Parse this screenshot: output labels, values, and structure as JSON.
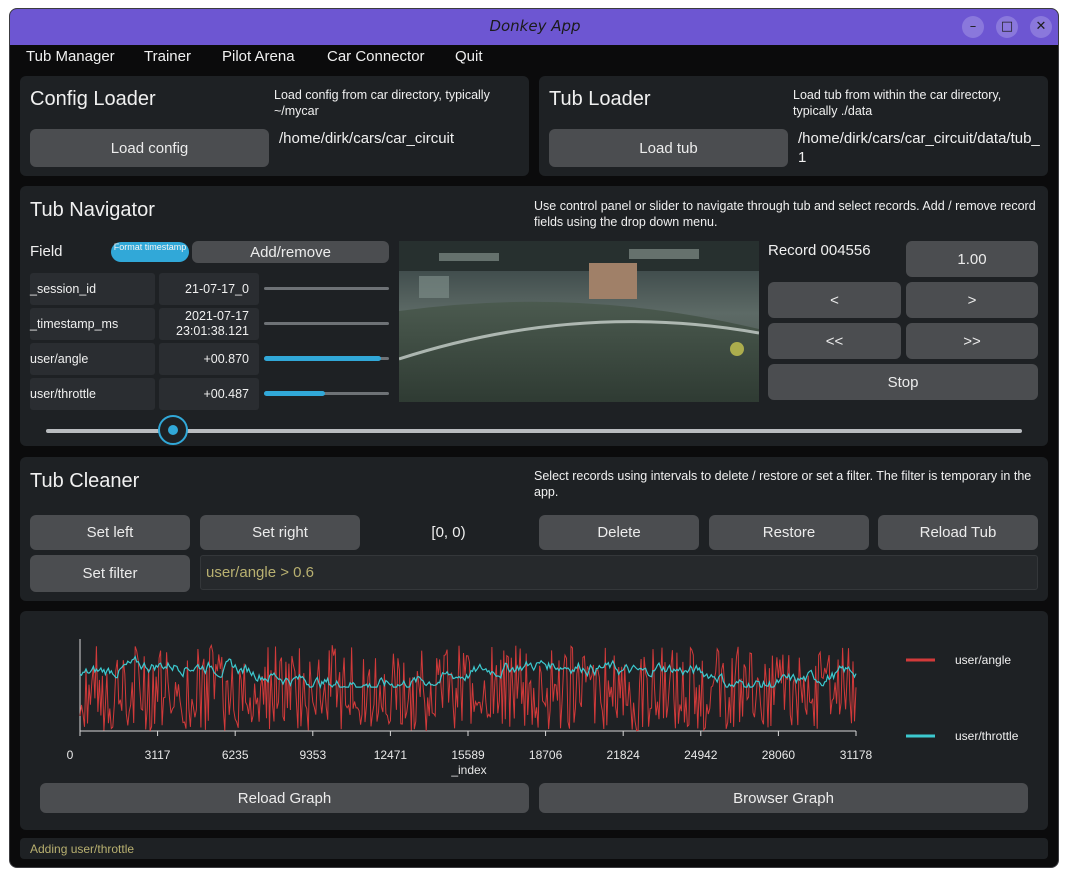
{
  "window": {
    "title": "Donkey App"
  },
  "menu": [
    "Tub Manager",
    "Trainer",
    "Pilot Arena",
    "Car Connector",
    "Quit"
  ],
  "config_loader": {
    "title": "Config Loader",
    "hint": "Load config from car directory, typically ~/mycar",
    "button": "Load config",
    "path": "/home/dirk/cars/car_circuit"
  },
  "tub_loader": {
    "title": "Tub Loader",
    "hint": "Load tub from within the car directory, typically ./data",
    "button": "Load tub",
    "path": "/home/dirk/cars/car_circuit/data/tub_1"
  },
  "navigator": {
    "title": "Tub Navigator",
    "hint": "Use control panel or slider to navigate through tub and select records. Add / remove record fields using the drop down menu.",
    "field_label": "Field",
    "format_button": "Format timestamp",
    "add_remove": "Add/remove",
    "fields": [
      {
        "name": "_session_id",
        "value": "21-07-17_0",
        "level": 1.0
      },
      {
        "name": "_timestamp_ms",
        "value": "2021-07-17\n23:01:38.121",
        "level": 1.0
      },
      {
        "name": "user/angle",
        "value": "+00.870",
        "level": 0.935
      },
      {
        "name": "user/throttle",
        "value": "+00.487",
        "level": 0.487
      }
    ],
    "record": "Record 004556",
    "speed": "1.00",
    "prev": "<",
    "next": ">",
    "fast_prev": "<<",
    "fast_next": ">>",
    "stop": "Stop",
    "slider_position": 0.1306
  },
  "cleaner": {
    "title": "Tub Cleaner",
    "hint": "Select records using intervals to delete / restore or set a filter. The filter is temporary in the app.",
    "set_left": "Set left",
    "set_right": "Set right",
    "interval": "[0, 0)",
    "delete": "Delete",
    "restore": "Restore",
    "reload_tub": "Reload Tub",
    "set_filter": "Set filter",
    "filter_value": "user/angle > 0.6"
  },
  "graph": {
    "reload": "Reload Graph",
    "browser": "Browser Graph"
  },
  "chart_data": {
    "type": "line",
    "xlabel": "_index",
    "xlim": [
      0,
      31178
    ],
    "xticks": [
      0,
      3117,
      6235,
      9353,
      12471,
      15589,
      18706,
      21824,
      24942,
      28060,
      31178
    ],
    "ylim": [
      -1,
      1
    ],
    "legend_placement": "right",
    "series": [
      {
        "name": "user/angle",
        "color": "#d23a3a",
        "pattern": "oscillating between -1 and 1"
      },
      {
        "name": "user/throttle",
        "color": "#3cc9cf",
        "pattern": "mostly between 0.1 and 0.7"
      }
    ]
  },
  "status": "Adding user/throttle",
  "colors": {
    "accent": "#6d56d2",
    "slider": "#31a8d8",
    "angle": "#d23a3a",
    "throttle": "#3cc9cf",
    "filter_text": "#b8b070"
  }
}
